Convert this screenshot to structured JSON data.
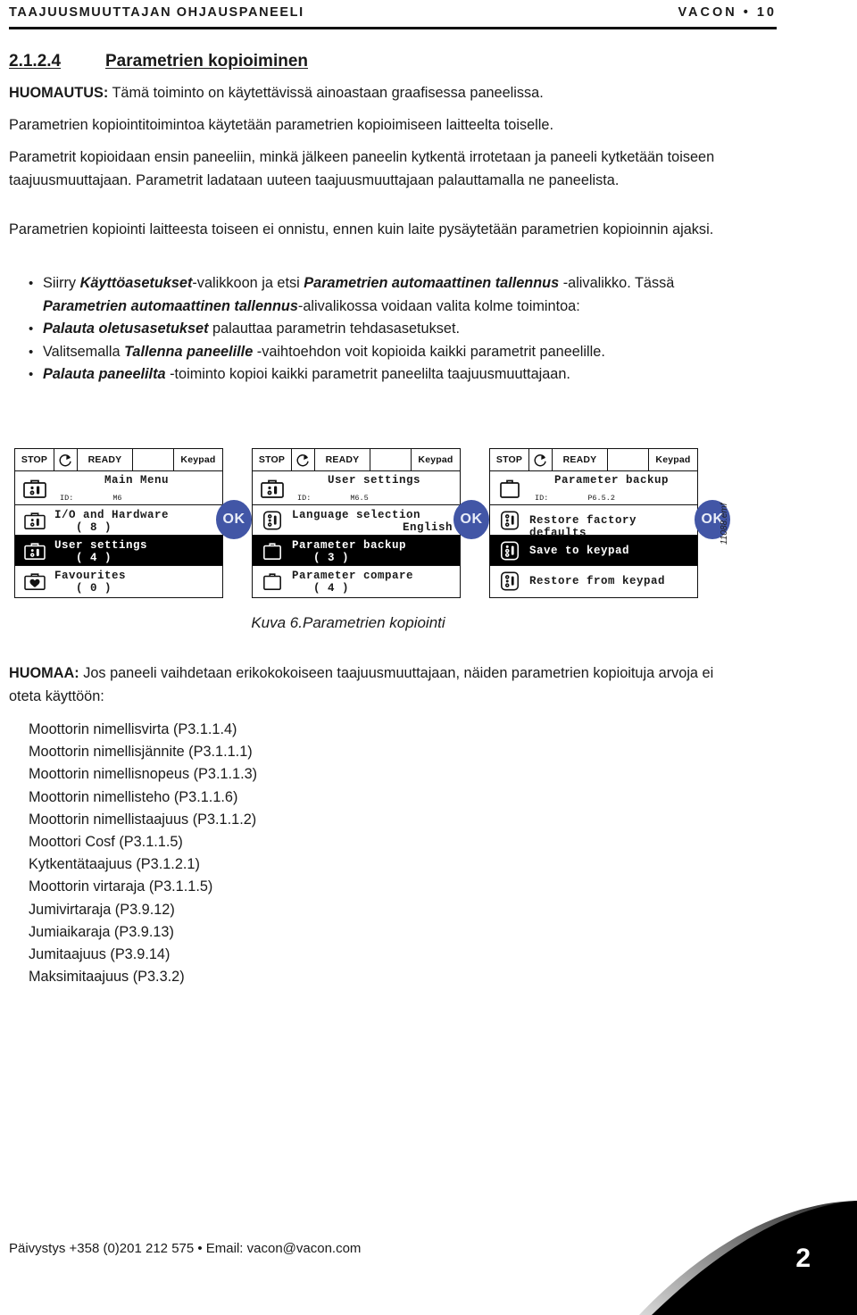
{
  "header": {
    "left_title": "Taajuusmuuttajan ohjauspaneeli",
    "right_title": "vacon • 10"
  },
  "section": {
    "number": "2.1.2.4",
    "title": "Parametrien kopioiminen"
  },
  "paragraphs": {
    "note_label": "HUOMAUTUS:",
    "note_text": " Tämä toiminto on käytettävissä ainoastaan graafisessa paneelissa.",
    "p1": "Parametrien kopiointitoimintoa käytetään parametrien kopioimiseen laitteelta toiselle.",
    "p2": "Parametrit kopioidaan ensin paneeliin, minkä jälkeen paneelin kytkentä irrotetaan ja paneeli kytketään toiseen taajuusmuuttajaan. Parametrit ladataan uuteen taajuusmuuttajaan palauttamalla ne paneelista.",
    "p3": "Parametrien kopiointi laitteesta toiseen ei onnistu, ennen kuin laite pysäytetään parametrien kopioinnin ajaksi."
  },
  "bullets": [
    {
      "parts": [
        {
          "t": "Siirry ",
          "style": "normal"
        },
        {
          "t": "Käyttöasetukset",
          "style": "italic"
        },
        {
          "t": "-valikkoon ja etsi ",
          "style": "normal"
        },
        {
          "t": "Parametrien automaattinen tallennus",
          "style": "italic"
        },
        {
          "t": " -alivalikko. Tässä ",
          "style": "normal"
        },
        {
          "t": "Parametrien automaattinen tallennus",
          "style": "italic"
        },
        {
          "t": "-alivalikossa voidaan valita kolme toimintoa:",
          "style": "normal"
        }
      ]
    },
    {
      "parts": [
        {
          "t": "Palauta oletusasetukset",
          "style": "italic"
        },
        {
          "t": " palauttaa parametrin tehdasasetukset.",
          "style": "normal"
        }
      ]
    },
    {
      "parts": [
        {
          "t": "Valitsemalla ",
          "style": "normal"
        },
        {
          "t": "Tallenna paneelille",
          "style": "italic"
        },
        {
          "t": " -vaihtoehdon voit kopioida kaikki parametrit paneelille.",
          "style": "normal"
        }
      ]
    },
    {
      "parts": [
        {
          "t": "Palauta paneelilta",
          "style": "italic"
        },
        {
          "t": " -toiminto kopioi kaikki parametrit paneelilta taajuusmuuttajaan.",
          "style": "normal"
        }
      ]
    }
  ],
  "figure": {
    "caption": "Kuva 6.Parametrien kopiointi",
    "emf_label": "11088.emf",
    "ok_label": "OK",
    "ok_color": "#4256a6",
    "statusbar": {
      "stop": "STOP",
      "rotation_icon": "rotation-arrow-icon",
      "ready": "READY",
      "blank": "",
      "keypad": "Keypad"
    },
    "panels": [
      {
        "name": "main-menu",
        "title": "Main Menu",
        "id_label": "ID:",
        "id_value": "M6",
        "title_icon": "toolbox-icon",
        "rows": [
          {
            "icon": "toolbox-icon",
            "label": "I/O and Hardware",
            "count": "( 8 )",
            "selected": false
          },
          {
            "icon": "toolbox-icon",
            "label": "User settings",
            "count": "( 4 )",
            "selected": true
          },
          {
            "icon": "heart-icon",
            "label": "Favourites",
            "count": "( 0 )",
            "selected": false
          }
        ]
      },
      {
        "name": "user-settings",
        "title": "User settings",
        "id_label": "ID:",
        "id_value": "M6.5",
        "title_icon": "toolbox-icon",
        "rows": [
          {
            "icon": "settings-dots-icon",
            "label": "Language selection",
            "count": "English",
            "count_right": true,
            "selected": false
          },
          {
            "icon": "briefcase-icon",
            "label": "Parameter backup",
            "count": "( 3 )",
            "selected": true
          },
          {
            "icon": "briefcase-icon",
            "label": "Parameter compare",
            "count": "( 4 )",
            "selected": false
          }
        ]
      },
      {
        "name": "parameter-backup",
        "title": "Parameter backup",
        "id_label": "ID:",
        "id_value": "P6.5.2",
        "title_icon": "briefcase-icon",
        "rows": [
          {
            "icon": "settings-dots-icon",
            "label": "Restore factory defaults",
            "count": "",
            "selected": false
          },
          {
            "icon": "settings-dots-icon",
            "label": "Save to keypad",
            "count": "",
            "selected": true
          },
          {
            "icon": "settings-dots-icon",
            "label": "Restore from keypad",
            "count": "",
            "selected": false
          }
        ]
      }
    ]
  },
  "note2": {
    "label": "HUOMAA:",
    "text": " Jos paneeli vaihdetaan erikokokoiseen taajuusmuuttajaan, näiden parametrien kopioituja arvoja ei oteta käyttöön:"
  },
  "param_list": [
    "Moottorin nimellisvirta (P3.1.1.4)",
    "Moottorin nimellisjännite (P3.1.1.1)",
    "Moottorin nimellisnopeus (P3.1.1.3)",
    "Moottorin nimellisteho (P3.1.1.6)",
    "Moottorin nimellistaajuus (P3.1.1.2)",
    "Moottori Cosf (P3.1.1.5)",
    "Kytkentätaajuus (P3.1.2.1)",
    "Moottorin virtaraja (P3.1.1.5)",
    "Jumivirtaraja (P3.9.12)",
    "Jumiaikaraja (P3.9.13)",
    "Jumitaajuus (P3.9.14)",
    "Maksimitaajuus (P3.3.2)"
  ],
  "footer": {
    "contact": "Päivystys +358 (0)201 212 575 • Email: vacon@vacon.com",
    "page_number": "2"
  }
}
